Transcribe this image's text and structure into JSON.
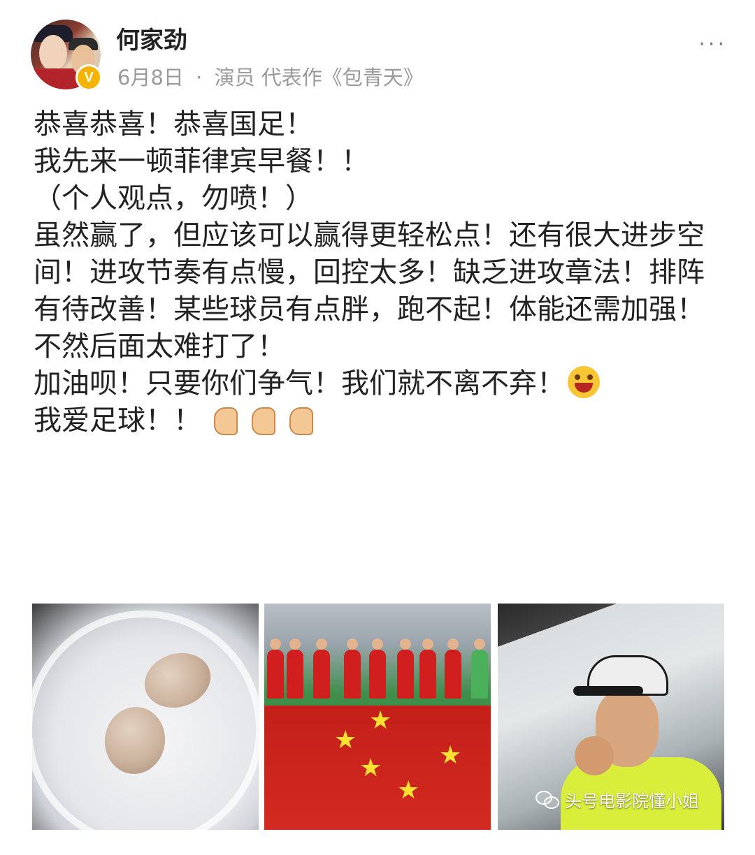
{
  "post": {
    "author": "何家劲",
    "date": "6月8日",
    "separator": "·",
    "bio": "演员 代表作《包青天》",
    "more_label": "···",
    "verified_badge": "V"
  },
  "content": {
    "lines": [
      "恭喜恭喜！恭喜国足！",
      "我先来一顿菲律宾早餐！！",
      "（个人观点，勿喷！）",
      "虽然赢了，但应该可以赢得更轻松点！还有很大进步空间！进攻节奏有点慢，回控太多！缺乏进攻章法！排阵有待改善！某些球员有点胖，跑不起！体能还需加强！不然后面太难打了！",
      "加油呗！只要你们争气！我们就不离不弃！",
      "我爱足球！！"
    ],
    "emoji": {
      "line5": "grinning-wink-emoji",
      "line6": [
        "flexed-biceps-emoji",
        "flexed-biceps-emoji",
        "flexed-biceps-emoji"
      ]
    }
  },
  "photos": [
    {
      "name": "photo-eggs-on-plate"
    },
    {
      "name": "photo-team-with-flag"
    },
    {
      "name": "photo-man-eating"
    }
  ],
  "watermark": {
    "text": "头号电影院懂小姐",
    "icon": "wechat-icon"
  },
  "colors": {
    "meta_gray": "#9a9a9a",
    "badge_gold": "#f6b400",
    "flag_red": "#d32a21",
    "shirt_lime": "#d8ee3b"
  }
}
